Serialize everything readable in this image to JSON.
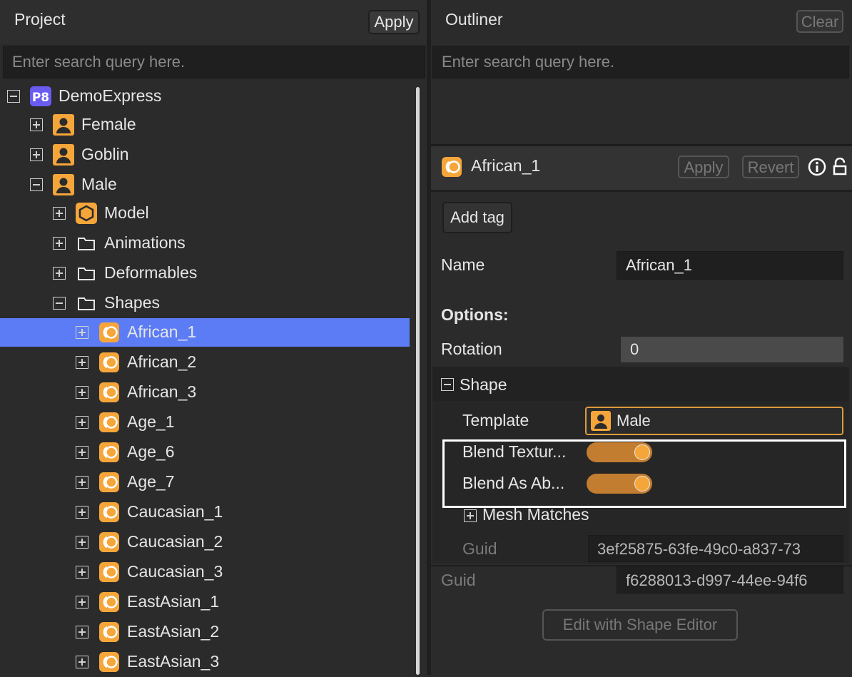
{
  "project": {
    "title": "Project",
    "apply_label": "Apply",
    "search_placeholder": "Enter search query here.",
    "tree": [
      {
        "label": "DemoExpress",
        "icon": "p8-project-icon",
        "expander": "minus"
      },
      {
        "label": "Female",
        "icon": "person-icon",
        "expander": "plus"
      },
      {
        "label": "Goblin",
        "icon": "person-icon",
        "expander": "plus"
      },
      {
        "label": "Male",
        "icon": "person-icon",
        "expander": "minus"
      },
      {
        "label": "Model",
        "icon": "hexagon-model-icon",
        "expander": "plus"
      },
      {
        "label": "Animations",
        "icon": "folder-icon",
        "expander": "plus"
      },
      {
        "label": "Deformables",
        "icon": "folder-icon",
        "expander": "plus"
      },
      {
        "label": "Shapes",
        "icon": "folder-icon",
        "expander": "minus"
      },
      {
        "label": "African_1",
        "icon": "shape-icon",
        "expander": "plus",
        "selected": true
      },
      {
        "label": "African_2",
        "icon": "shape-icon",
        "expander": "plus"
      },
      {
        "label": "African_3",
        "icon": "shape-icon",
        "expander": "plus"
      },
      {
        "label": "Age_1",
        "icon": "shape-icon",
        "expander": "plus"
      },
      {
        "label": "Age_6",
        "icon": "shape-icon",
        "expander": "plus"
      },
      {
        "label": "Age_7",
        "icon": "shape-icon",
        "expander": "plus"
      },
      {
        "label": "Caucasian_1",
        "icon": "shape-icon",
        "expander": "plus"
      },
      {
        "label": "Caucasian_2",
        "icon": "shape-icon",
        "expander": "plus"
      },
      {
        "label": "Caucasian_3",
        "icon": "shape-icon",
        "expander": "plus"
      },
      {
        "label": "EastAsian_1",
        "icon": "shape-icon",
        "expander": "plus"
      },
      {
        "label": "EastAsian_2",
        "icon": "shape-icon",
        "expander": "plus"
      },
      {
        "label": "EastAsian_3",
        "icon": "shape-icon",
        "expander": "plus"
      }
    ]
  },
  "outliner": {
    "title": "Outliner",
    "clear_label": "Clear",
    "search_placeholder": "Enter search query here."
  },
  "inspector": {
    "asset_name": "African_1",
    "apply_label": "Apply",
    "revert_label": "Revert",
    "add_tag_label": "Add tag",
    "name_label": "Name",
    "name_value": "African_1",
    "options_label": "Options:",
    "rotation_label": "Rotation",
    "rotation_value": "0",
    "shape_section_label": "Shape",
    "template_label": "Template",
    "template_value": "Male",
    "blend_textures_label": "Blend Textur...",
    "blend_textures_on": true,
    "blend_absolute_label": "Blend As Ab...",
    "blend_absolute_on": true,
    "mesh_matches_label": "Mesh Matches",
    "inner_guid_label": "Guid",
    "inner_guid_value": "3ef25875-63fe-49c0-a837-73",
    "guid_label": "Guid",
    "guid_value": "f6288013-d997-44ee-94f6",
    "edit_button_label": "Edit with Shape Editor"
  },
  "colors": {
    "selection": "#5b7cf5",
    "accent_orange": "#f5a63a",
    "project_badge": "#6a5cf0"
  }
}
